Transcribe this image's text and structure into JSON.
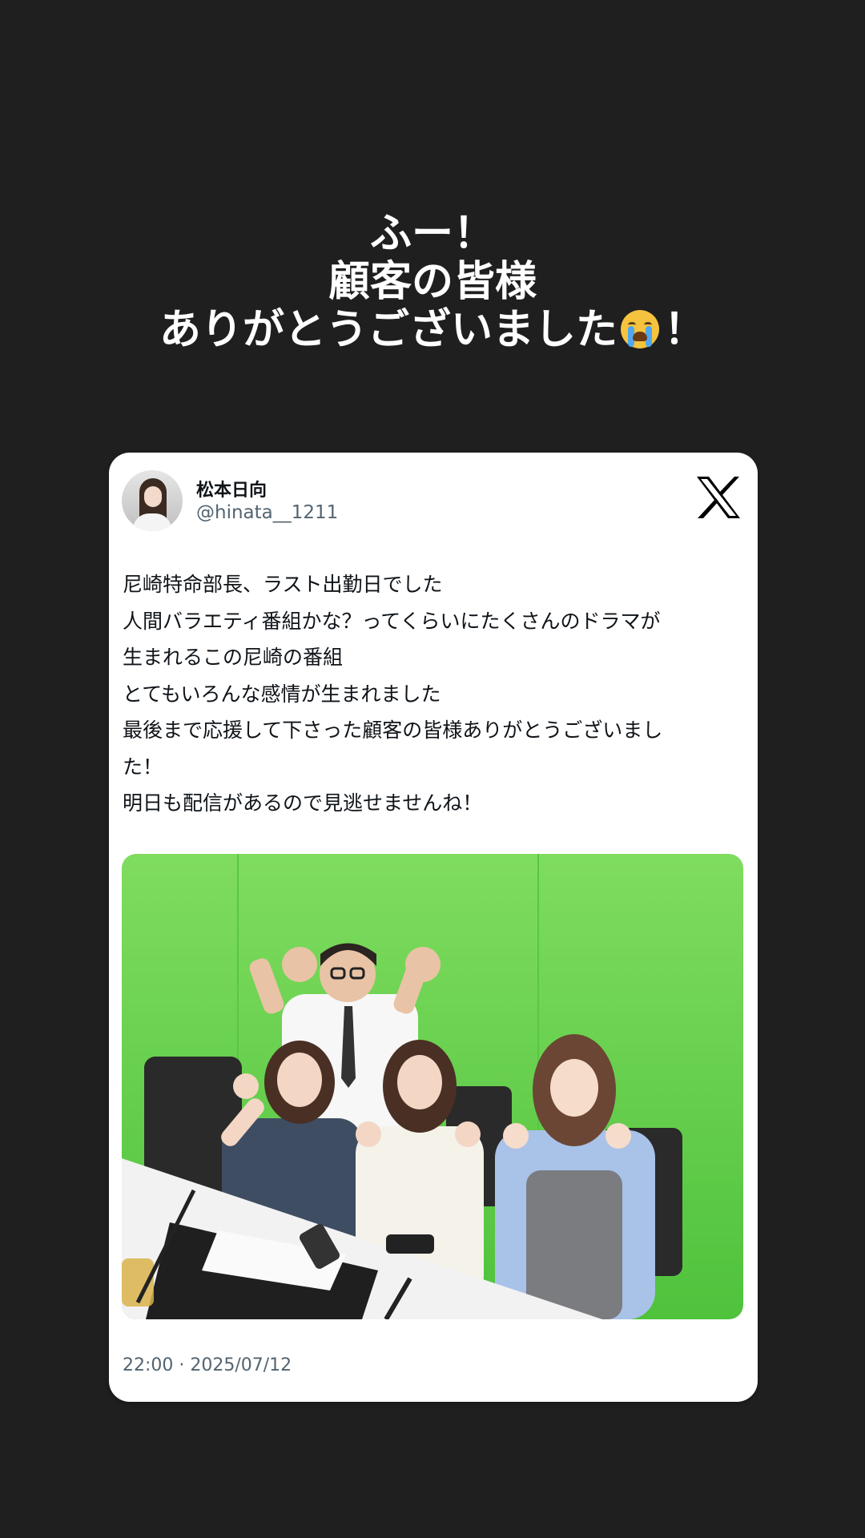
{
  "story": {
    "caption": {
      "line1": "ふー！",
      "line2": "顧客の皆様",
      "line3_text": "ありがとうございました",
      "line3_emoji": "loudly-crying-face-icon",
      "line3_end": "！"
    }
  },
  "tweet": {
    "display_name": "松本日向",
    "handle": "@hinata__1211",
    "platform_icon": "x-logo-icon",
    "text_lines": [
      "尼崎特命部長、ラスト出勤日でした",
      "人間バラエティ番組かな？ってくらいにたくさんのドラマが",
      "生まれるこの尼崎の番組",
      "とてもいろんな感情が生まれました",
      "最後まで応援して下さった顧客の皆様ありがとうございまし",
      "た！",
      "明日も配信があるので見逃せませんね！"
    ],
    "timestamp": "22:00 · 2025/07/12"
  },
  "colors": {
    "background": "#1f1f1f",
    "card": "#ffffff",
    "text_primary": "#0f1419",
    "text_secondary": "#536471",
    "green_screen": "#5fcf4a"
  }
}
